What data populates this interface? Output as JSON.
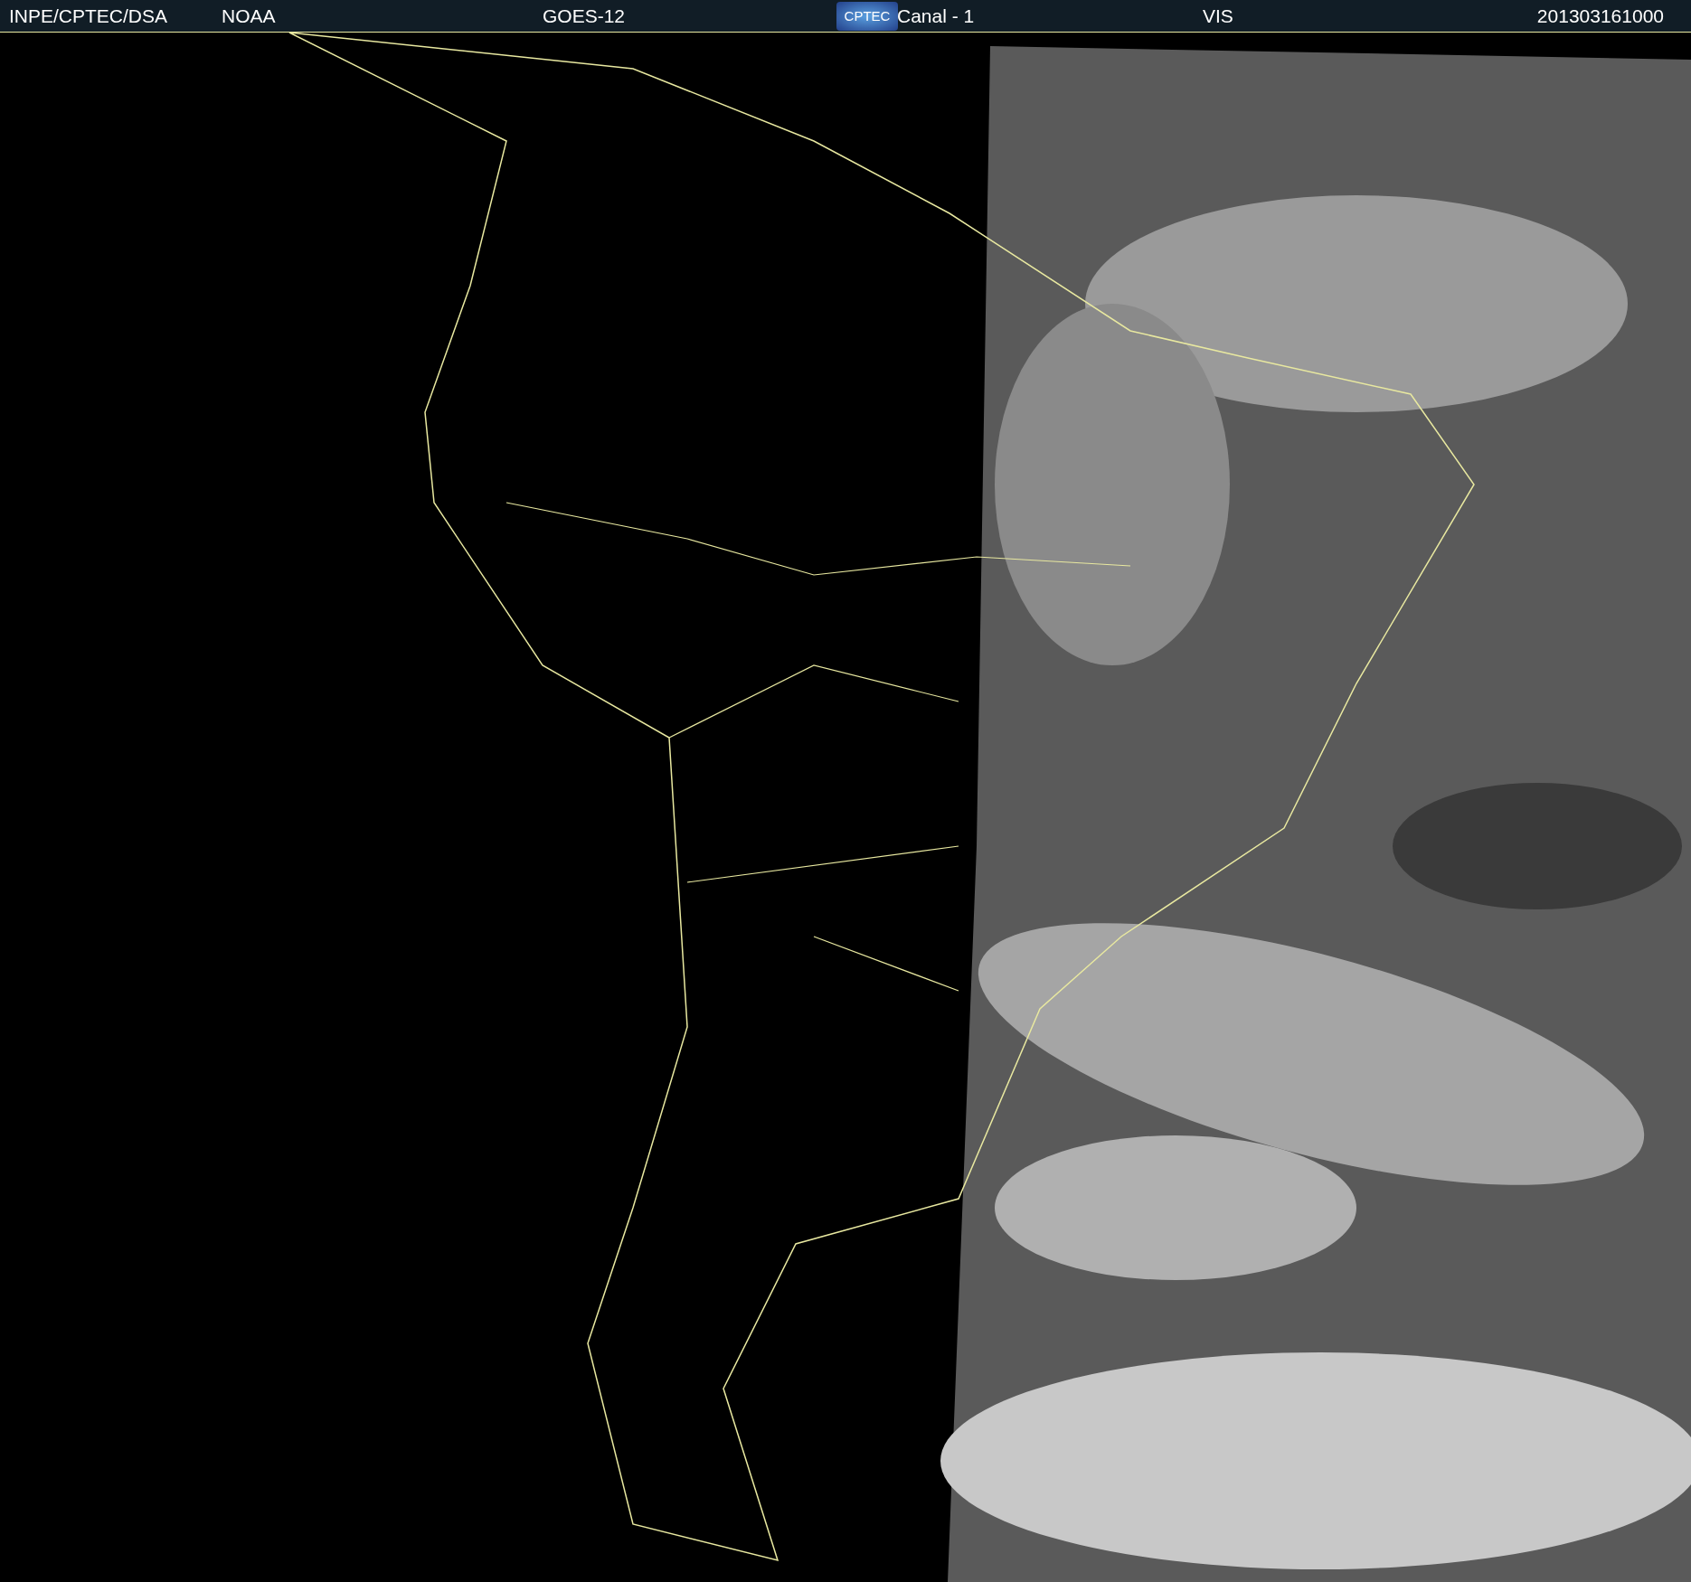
{
  "header": {
    "source": "INPE/CPTEC/DSA",
    "agency": "NOAA",
    "satellite": "GOES-12",
    "logo": "CPTEC",
    "channel": "Canal - 1",
    "band": "VIS",
    "timestamp": "201303161000"
  }
}
